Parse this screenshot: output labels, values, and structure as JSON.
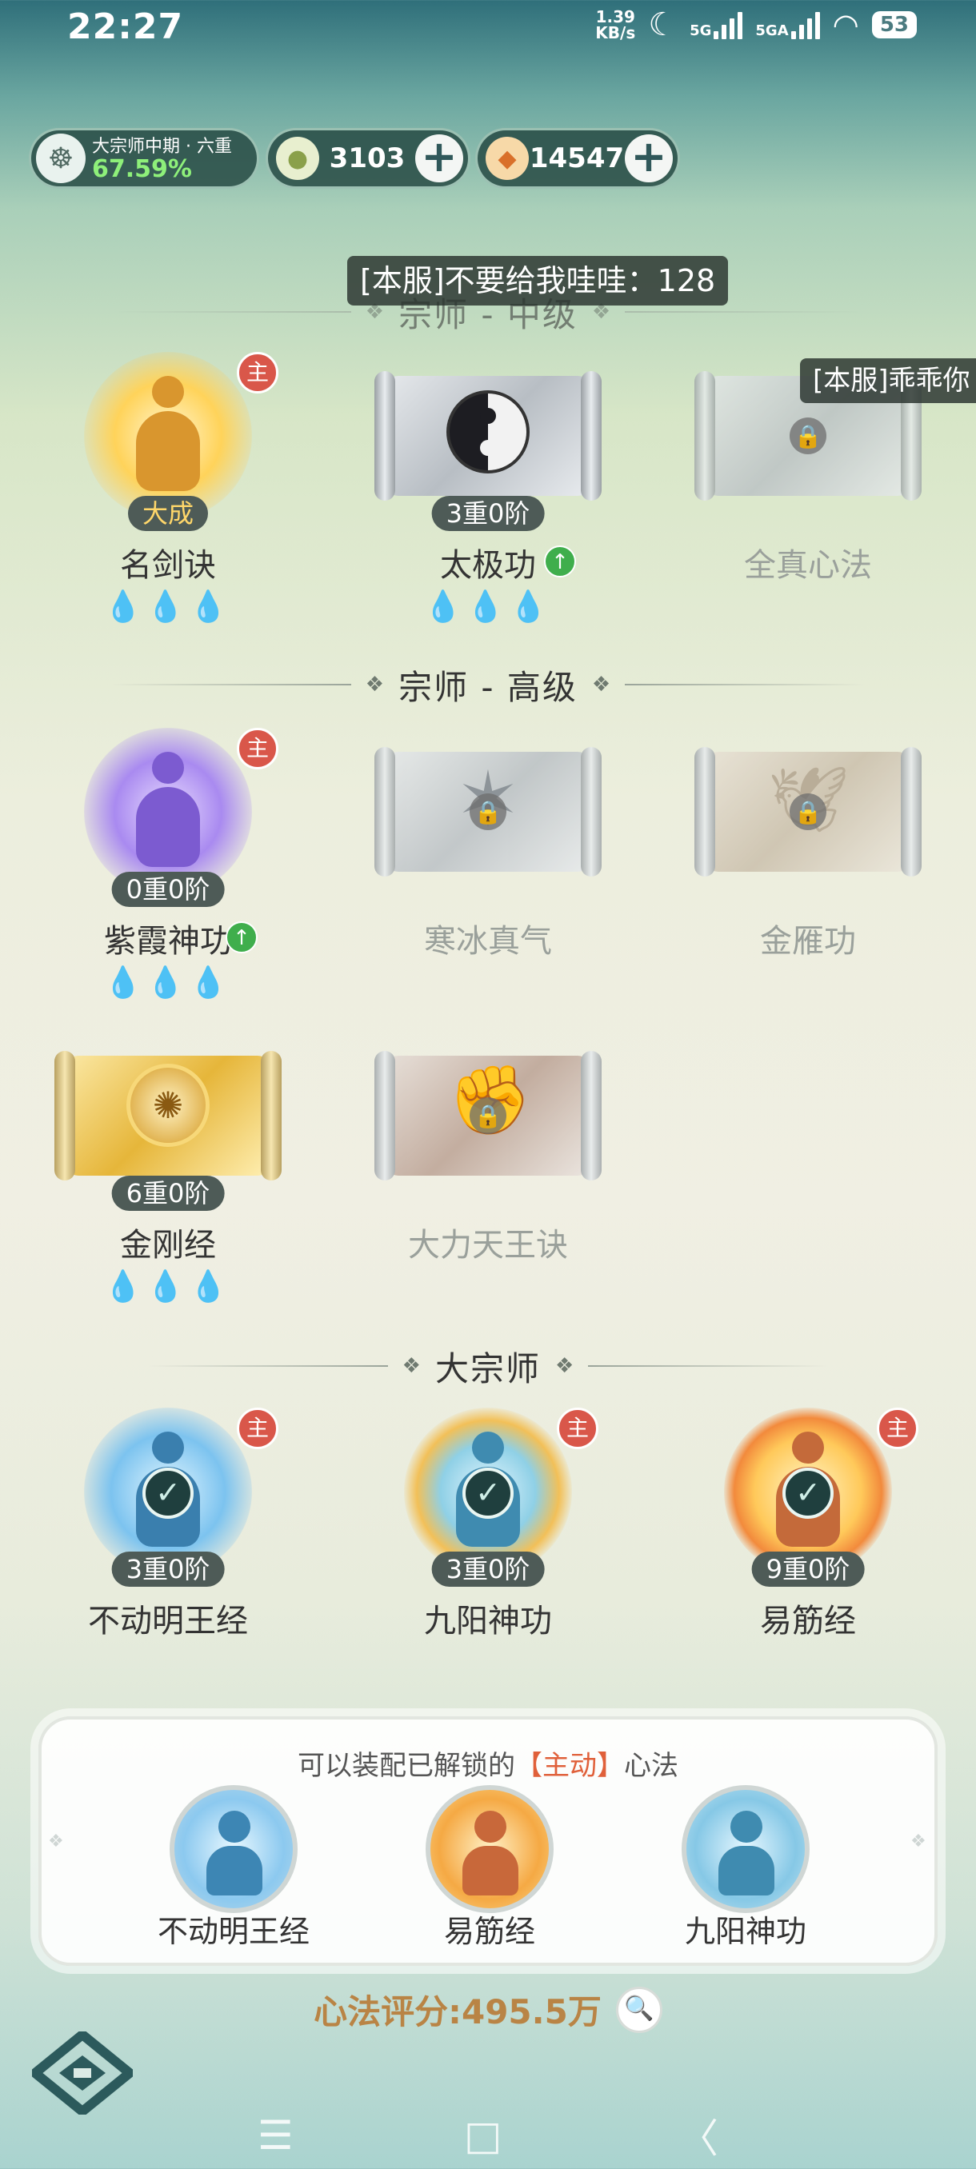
{
  "status": {
    "time": "22:27",
    "speed_value": "1.39",
    "speed_unit": "KB/s",
    "net1": "5G",
    "net2": "5GA",
    "battery": "53"
  },
  "resources": {
    "rank": "大宗师中期 · 六重",
    "rank_pct": "67.59%",
    "currency1": "3103",
    "currency2": "14547",
    "plus": "+"
  },
  "danmaku": {
    "msg1": "[本服]不要给我哇哇：128",
    "msg2": "[本服]乖乖你"
  },
  "sections": {
    "s1": "宗师 - 中级",
    "s2": "宗师 - 高级",
    "s3": "大宗师"
  },
  "icons": {
    "zhu": "主",
    "lock": "🔒",
    "check": "✓",
    "up": "↑",
    "drop": "💧",
    "search": "🔍"
  },
  "skills": {
    "mingjianjue": {
      "tag": "大成",
      "name": "名剑诀"
    },
    "taijigong": {
      "tag": "3重0阶",
      "name": "太极功"
    },
    "quanzhen": {
      "name": "全真心法"
    },
    "zixia": {
      "tag": "0重0阶",
      "name": "紫霞神功"
    },
    "hanbing": {
      "name": "寒冰真气"
    },
    "jinyan": {
      "name": "金雁功"
    },
    "jingang": {
      "tag": "6重0阶",
      "name": "金刚经"
    },
    "dali": {
      "name": "大力天王诀"
    },
    "budong": {
      "tag": "3重0阶",
      "name": "不动明王经"
    },
    "jiuyang": {
      "tag": "3重0阶",
      "name": "九阳神功"
    },
    "yijin": {
      "tag": "9重0阶",
      "name": "易筋经"
    }
  },
  "equip": {
    "title_pre": "可以装配已解锁的",
    "title_hl": "【主动】",
    "title_post": "心法",
    "slots": [
      "不动明王经",
      "易筋经",
      "九阳神功"
    ]
  },
  "score": {
    "text": "心法评分:495.5万"
  },
  "nav": {
    "menu": "☰",
    "home": "□",
    "back": "〈"
  }
}
